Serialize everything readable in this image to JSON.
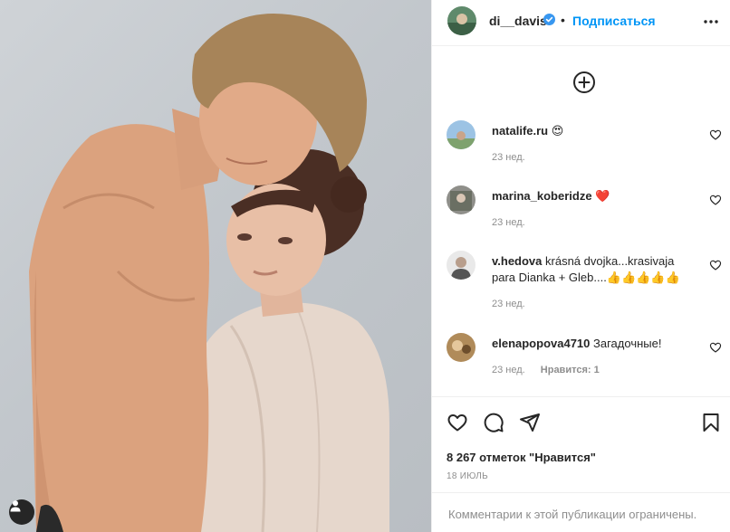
{
  "post": {
    "username": "di__davis",
    "separator": "•",
    "follow_label": "Подписаться"
  },
  "comments": [
    {
      "user": "natalife.ru",
      "text": "😍",
      "time": "23 нед.",
      "likes_label": ""
    },
    {
      "user": "marina_koberidze",
      "text": "❤️",
      "time": "23 нед.",
      "likes_label": ""
    },
    {
      "user": "v.hedova",
      "text": "krásná dvojka...krasivaja para Dianka + Gleb....👍👍👍👍👍",
      "time": "23 нед.",
      "likes_label": ""
    },
    {
      "user": "elenapopova4710",
      "text": "Загадочные!",
      "time": "23 нед.",
      "likes_label": "Нравится: 1"
    }
  ],
  "footer": {
    "likes_text": "8 267 отметок \"Нравится\"",
    "date": "18 ИЮЛЬ",
    "comments_disabled": "Комментарии к этой публикации ограничены."
  },
  "colors": {
    "accent": "#0095f6",
    "verified": "#3897f0",
    "text": "#262626",
    "muted": "#8e8e8e"
  },
  "icons": [
    "user-tag-icon",
    "verified-icon",
    "more-icon",
    "add-circle-icon",
    "heart-icon",
    "comment-icon",
    "share-icon",
    "bookmark-icon"
  ]
}
